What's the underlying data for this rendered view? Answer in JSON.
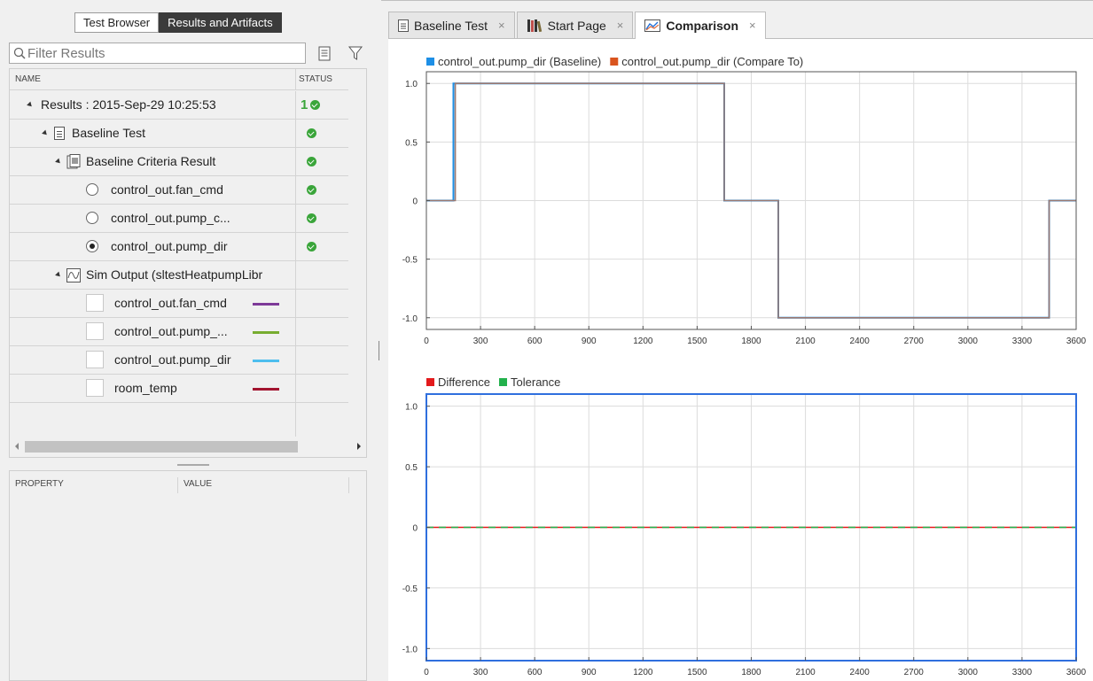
{
  "left_tabs": [
    {
      "label": "Test Browser",
      "active": false
    },
    {
      "label": "Results and Artifacts",
      "active": true
    }
  ],
  "filter": {
    "placeholder": "Filter Results"
  },
  "tree_headers": {
    "name": "NAME",
    "status": "STATUS"
  },
  "tree_rows": [
    {
      "label": "Results : 2015-Sep-29 10:25:53",
      "status_text": "1"
    },
    {
      "label": "Baseline Test"
    },
    {
      "label": "Baseline Criteria Result"
    },
    {
      "label": "control_out.fan_cmd"
    },
    {
      "label": "control_out.pump_c..."
    },
    {
      "label": "control_out.pump_dir",
      "selected": true
    },
    {
      "label": "Sim Output (sltestHeatpumpLibr"
    },
    {
      "label": "control_out.fan_cmd",
      "color": "#7d3a98"
    },
    {
      "label": "control_out.pump_...",
      "color": "#77ac30"
    },
    {
      "label": "control_out.pump_dir",
      "color": "#4dbeee"
    },
    {
      "label": "room_temp",
      "color": "#a2142f"
    }
  ],
  "property_headers": {
    "property": "PROPERTY",
    "value": "VALUE"
  },
  "doc_tabs": [
    {
      "label": "Baseline Test",
      "close": "×",
      "icon": "document-icon",
      "active": false
    },
    {
      "label": "Start Page",
      "close": "×",
      "icon": "library-books-icon",
      "active": false
    },
    {
      "label": "Comparison",
      "close": "×",
      "icon": "chart-icon",
      "active": true
    }
  ],
  "chart_data": [
    {
      "type": "line",
      "series": [
        {
          "name": "control_out.pump_dir (Baseline)",
          "color": "#1e8fe6",
          "x": [
            0,
            150,
            150,
            1650,
            1650,
            1950,
            1950,
            3450,
            3450,
            3600
          ],
          "y": [
            0,
            0,
            1,
            1,
            0,
            0,
            -1,
            -1,
            0,
            0
          ]
        },
        {
          "name": "control_out.pump_dir (Compare To)",
          "color": "#d9541e",
          "x": [
            0,
            160,
            160,
            1650,
            1650,
            1950,
            1950,
            3450,
            3450,
            3600
          ],
          "y": [
            0,
            0,
            1,
            1,
            0,
            0,
            -1,
            -1,
            0,
            0
          ]
        }
      ],
      "xlim": [
        0,
        3600
      ],
      "ylim": [
        -1.1,
        1.1
      ],
      "xticks": [
        0,
        300,
        600,
        900,
        1200,
        1500,
        1800,
        2100,
        2400,
        2700,
        3000,
        3300,
        3600
      ],
      "xtick_labels": [
        "0",
        "300",
        "600",
        "900",
        "1200",
        "1500",
        "1800",
        "2100",
        "2400",
        "2700",
        "3000",
        "3300",
        "3600"
      ],
      "yticks": [
        1.0,
        0.5,
        0,
        -0.5,
        -1.0
      ],
      "ytick_labels": [
        "1.0",
        "0.5",
        "0",
        "-0.5",
        "-1.0"
      ],
      "grid": true,
      "legend": "top-left"
    },
    {
      "type": "line",
      "series": [
        {
          "name": "Difference",
          "color": "#e31a1c",
          "x": [
            0,
            3600
          ],
          "y": [
            0,
            0
          ]
        },
        {
          "name": "Tolerance",
          "color": "#22b14c",
          "x": [
            0,
            3600
          ],
          "y": [
            0,
            0
          ]
        }
      ],
      "xlim": [
        0,
        3600
      ],
      "ylim": [
        -1.1,
        1.1
      ],
      "xticks": [
        0,
        300,
        600,
        900,
        1200,
        1500,
        1800,
        2100,
        2400,
        2700,
        3000,
        3300,
        3600
      ],
      "xtick_labels": [
        "0",
        "300",
        "600",
        "900",
        "1200",
        "1500",
        "1800",
        "2100",
        "2400",
        "2700",
        "3000",
        "3300",
        "3600"
      ],
      "yticks": [
        1.0,
        0.5,
        0,
        -0.5,
        -1.0
      ],
      "ytick_labels": [
        "1.0",
        "0.5",
        "0",
        "-0.5",
        "-1.0"
      ],
      "grid": true,
      "legend": "top-left",
      "selected": true
    }
  ]
}
